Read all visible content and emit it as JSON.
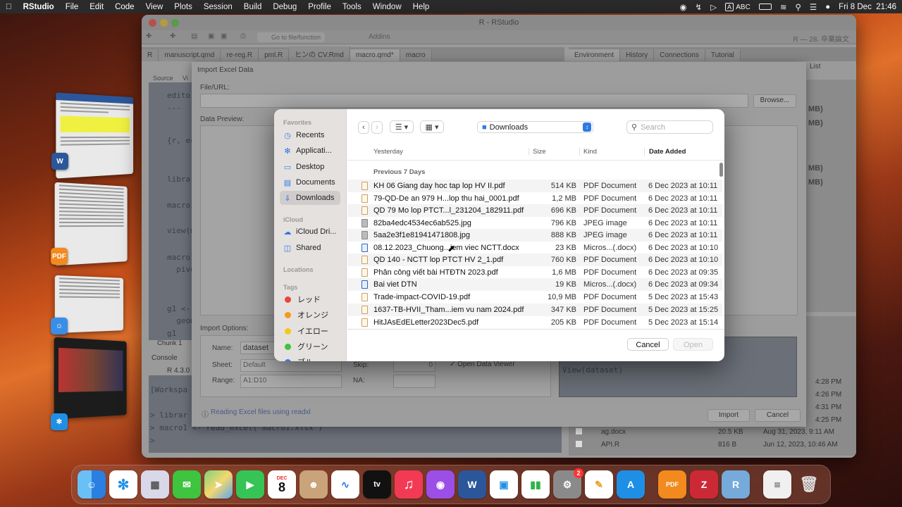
{
  "menubar": {
    "app": "RStudio",
    "items": [
      "File",
      "Edit",
      "Code",
      "View",
      "Plots",
      "Session",
      "Build",
      "Debug",
      "Profile",
      "Tools",
      "Window",
      "Help"
    ],
    "input_badge": "A",
    "input_source": "ABC",
    "datetime": "Fri 8 Dec  21:46"
  },
  "rstudio": {
    "title": "R - RStudio",
    "goto_placeholder": "Go to file/function",
    "addins": "Addins",
    "project": "R — 28. 卒業論文",
    "source_tabs": [
      "R",
      "manuscript.qmd",
      "re-reg.R",
      "pml.R",
      "ヒンの CV.Rmd",
      "macro.qmd*",
      "macro"
    ],
    "sub_tabs": [
      "Source",
      "Vi"
    ],
    "env_tabs": [
      "Environment",
      "History",
      "Connections",
      "Tutorial"
    ],
    "list_label": "List",
    "editor_lines": [
      "editor",
      "---",
      "{r, ec",
      "librar",
      "macro1",
      "view(m",
      "macro1",
      "  pivo",
      "g1 <-",
      "  geom",
      "g1"
    ],
    "chunk_label": "Chunk 1",
    "console_tab": "Console",
    "r_version": "R 4.3.0",
    "console_lines": [
      "[Workspa",
      "> librar",
      "> macro1 <- read_excel(\"macro1.xlsx\")",
      ">"
    ],
    "env_sizes": [
      "MB)",
      "MB)",
      "MB)",
      "MB)"
    ],
    "files": [
      {
        "name": "ag.docx",
        "size": "20.5 KB",
        "modified": "Aug 31, 2023, 9:11 AM"
      },
      {
        "name": "API.R",
        "size": "816 B",
        "modified": "Jun 12, 2023, 10:46 AM"
      }
    ],
    "file_times": [
      "4:28 PM",
      "4:26 PM",
      "4:31 PM",
      "4:25 PM"
    ]
  },
  "import_dialog": {
    "title": "Import Excel Data",
    "file_url_label": "File/URL:",
    "browse": "Browse...",
    "data_preview": "Data Preview:",
    "import_options": "Import Options:",
    "name_label": "Name:",
    "name_value": "dataset",
    "sheet_label": "Sheet:",
    "sheet_value": "Default",
    "range_label": "Range:",
    "range_placeholder": "A1:D10",
    "skip_label": "Skip:",
    "skip_value": "0",
    "na_label": "NA:",
    "open_viewer": "✓ Open Data Viewer",
    "code_preview": "View(dataset)",
    "help_link": "Reading Excel files using readxl",
    "import_btn": "Import",
    "cancel_btn": "Cancel"
  },
  "file_dialog": {
    "sidebar": {
      "favorites_title": "Favorites",
      "favorites": [
        {
          "label": "Recents",
          "icon": "clock-icon"
        },
        {
          "label": "Applicati...",
          "icon": "applications-icon"
        },
        {
          "label": "Desktop",
          "icon": "desktop-icon"
        },
        {
          "label": "Documents",
          "icon": "document-icon"
        },
        {
          "label": "Downloads",
          "icon": "download-icon"
        }
      ],
      "icloud_title": "iCloud",
      "icloud": [
        {
          "label": "iCloud Dri...",
          "icon": "cloud-icon"
        },
        {
          "label": "Shared",
          "icon": "shared-folder-icon"
        }
      ],
      "locations_title": "Locations",
      "tags_title": "Tags",
      "tags": [
        {
          "label": "レッド",
          "color": "#e8453c"
        },
        {
          "label": "オレンジ",
          "color": "#f39a1e"
        },
        {
          "label": "イエロー",
          "color": "#f2c81f"
        },
        {
          "label": "グリーン",
          "color": "#3ec43e"
        },
        {
          "label": "ブル",
          "color": "#3478f6"
        }
      ]
    },
    "location": "Downloads",
    "search_placeholder": "Search",
    "columns": {
      "name": "Yesterday",
      "size": "Size",
      "kind": "Kind",
      "date": "Date Added"
    },
    "group": "Previous 7 Days",
    "rows": [
      {
        "name": "KH 06 Giang day hoc tap lop HV II.pdf",
        "size": "514 KB",
        "kind": "PDF Document",
        "date": "6 Dec 2023 at 10:11",
        "type": "pdf"
      },
      {
        "name": "79-QD-De an 979 H...lop thu hai_0001.pdf",
        "size": "1,2 MB",
        "kind": "PDF Document",
        "date": "6 Dec 2023 at 10:11",
        "type": "pdf"
      },
      {
        "name": "QD 79 Mo lop PTCT...l_231204_182911.pdf",
        "size": "696 KB",
        "kind": "PDF Document",
        "date": "6 Dec 2023 at 10:11",
        "type": "pdf"
      },
      {
        "name": "82ba4edc4534ec6ab525.jpg",
        "size": "796 KB",
        "kind": "JPEG image",
        "date": "6 Dec 2023 at 10:11",
        "type": "img"
      },
      {
        "name": "5aa2e3f1e81941471808.jpg",
        "size": "888 KB",
        "kind": "JPEG image",
        "date": "6 Dec 2023 at 10:11",
        "type": "img"
      },
      {
        "name": "08.12.2023_Chuong...iem viec NCTT.docx",
        "size": "23 KB",
        "kind": "Micros...(.docx)",
        "date": "6 Dec 2023 at 10:10",
        "type": "doc"
      },
      {
        "name": "QD 140 - NCTT lop PTCT HV 2_1.pdf",
        "size": "760 KB",
        "kind": "PDF Document",
        "date": "6 Dec 2023 at 10:10",
        "type": "pdf"
      },
      {
        "name": "Phân công viết bài HTĐTN 2023.pdf",
        "size": "1,6 MB",
        "kind": "PDF Document",
        "date": "6 Dec 2023 at 09:35",
        "type": "pdf"
      },
      {
        "name": "Bai viet DTN",
        "size": "19 KB",
        "kind": "Micros...(.docx)",
        "date": "6 Dec 2023 at 09:34",
        "type": "doc"
      },
      {
        "name": "Trade-impact-COVID-19.pdf",
        "size": "10,9 MB",
        "kind": "PDF Document",
        "date": "5 Dec 2023 at 15:43",
        "type": "pdf"
      },
      {
        "name": "1637-TB-HVII_Tham...iem vu nam 2024.pdf",
        "size": "347 KB",
        "kind": "PDF Document",
        "date": "5 Dec 2023 at 15:25",
        "type": "pdf"
      },
      {
        "name": "HitJAsEdELetter2023Dec5.pdf",
        "size": "205 KB",
        "kind": "PDF Document",
        "date": "5 Dec 2023 at 15:14",
        "type": "pdf"
      }
    ],
    "cancel": "Cancel",
    "open": "Open"
  },
  "dock": {
    "calendar_month": "DEC",
    "calendar_day": "8",
    "settings_badge": "2"
  }
}
